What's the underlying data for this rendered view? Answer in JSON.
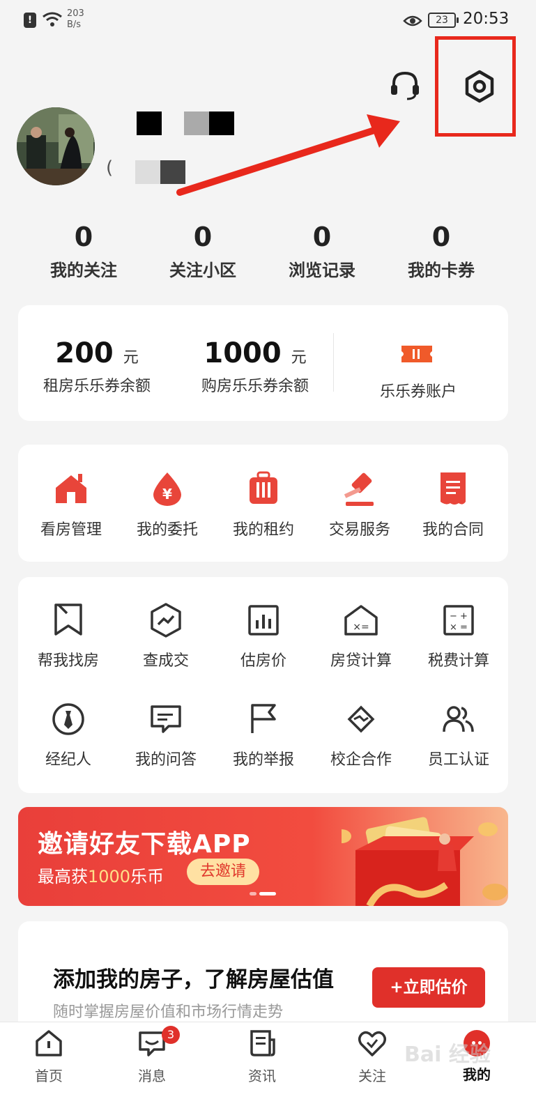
{
  "status_bar": {
    "net_speed_value": "203",
    "net_speed_unit": "B/s",
    "battery": "23",
    "time": "20:53"
  },
  "stats": [
    {
      "value": "0",
      "label": "我的关注"
    },
    {
      "value": "0",
      "label": "关注小区"
    },
    {
      "value": "0",
      "label": "浏览记录"
    },
    {
      "value": "0",
      "label": "我的卡券"
    }
  ],
  "coupons": {
    "rent_amount": "200",
    "rent_unit": "元",
    "rent_label": "租房乐乐券余额",
    "buy_amount": "1000",
    "buy_unit": "元",
    "buy_label": "购房乐乐券余额",
    "account_label": "乐乐券账户"
  },
  "primary_menu": [
    {
      "icon": "house-icon",
      "label": "看房管理"
    },
    {
      "icon": "yuan-drop-icon",
      "label": "我的委托"
    },
    {
      "icon": "suitcase-icon",
      "label": "我的租约"
    },
    {
      "icon": "gavel-icon",
      "label": "交易服务"
    },
    {
      "icon": "document-icon",
      "label": "我的合同"
    }
  ],
  "tools_menu": [
    {
      "icon": "bookmark-icon",
      "label": "帮我找房"
    },
    {
      "icon": "trend-icon",
      "label": "查成交"
    },
    {
      "icon": "bar-chart-icon",
      "label": "估房价"
    },
    {
      "icon": "loan-calc-icon",
      "label": "房贷计算"
    },
    {
      "icon": "calculator-icon",
      "label": "税费计算"
    },
    {
      "icon": "tie-icon",
      "label": "经纪人"
    },
    {
      "icon": "chat-icon",
      "label": "我的问答"
    },
    {
      "icon": "flag-icon",
      "label": "我的举报"
    },
    {
      "icon": "handshake-icon",
      "label": "校企合作"
    },
    {
      "icon": "users-icon",
      "label": "员工认证"
    }
  ],
  "banner": {
    "title": "邀请好友下载APP",
    "sub_prefix": "最高获",
    "sub_highlight": "1000",
    "sub_suffix": "乐币",
    "button": "去邀请"
  },
  "valuation": {
    "title": "添加我的房子，了解房屋估值",
    "subtitle": "随时掌握房屋价值和市场行情走势",
    "button": "+立即估价"
  },
  "bottom_nav": [
    {
      "icon": "home-icon",
      "label": "首页"
    },
    {
      "icon": "message-icon",
      "label": "消息",
      "badge": "3"
    },
    {
      "icon": "news-icon",
      "label": "资讯"
    },
    {
      "icon": "heart-icon",
      "label": "关注"
    },
    {
      "icon": "profile-icon",
      "label": "我的",
      "active": true
    }
  ],
  "watermark": "Bai 经验",
  "colors": {
    "accent": "#e0302a",
    "annotation": "#e8281c",
    "background": "#f4f4f4"
  }
}
